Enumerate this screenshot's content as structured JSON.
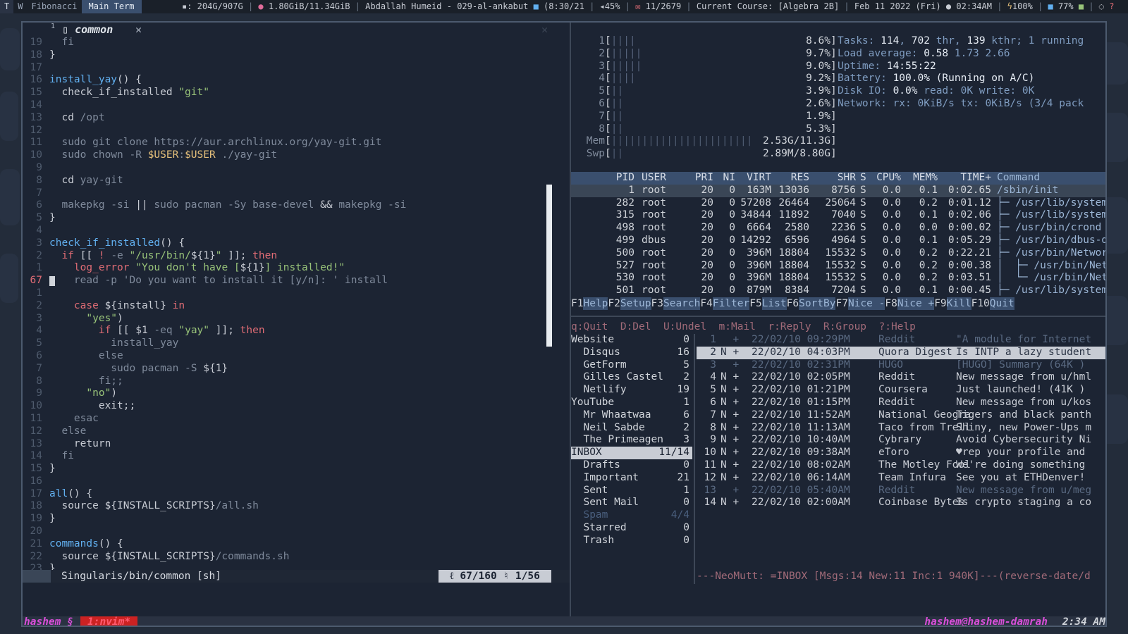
{
  "topbar": {
    "workspaces": [
      "T",
      "W",
      "Fibonacci",
      "Main Term"
    ],
    "disk": ": 204G/907G",
    "mem": "1.80GiB/11.34GiB",
    "now_playing": "Abdallah Humeid - 029-al-ankabut",
    "track_time": "(8:30/21",
    "volume": "45%",
    "mail_count": "11/2679",
    "course": "Current Course: [Algebra 2B]",
    "date": "Feb 11 2022 (Fri)",
    "time": "02:34AM",
    "battery": "100%",
    "brightness": "77%"
  },
  "editor": {
    "tab_number": "1",
    "tab_title": "common",
    "close_glyph": "✕",
    "lines": [
      {
        "n": "19",
        "html": "<span class='dim'>  fi</span>"
      },
      {
        "n": "18",
        "html": "}"
      },
      {
        "n": "17",
        "html": ""
      },
      {
        "n": "16",
        "html": "<span class='fn'>install_yay</span>() {"
      },
      {
        "n": "15",
        "html": "  check_if_installed <span class='str'>\"git\"</span>"
      },
      {
        "n": "14",
        "html": ""
      },
      {
        "n": "13",
        "html": "  cd <span class='dim'>/opt</span>"
      },
      {
        "n": "12",
        "html": ""
      },
      {
        "n": "11",
        "html": "<span class='dim'>  sudo git clone https://aur.archlinux.org/yay-git.git</span>"
      },
      {
        "n": "10",
        "html": "<span class='dim'>  sudo chown -R </span><span class='var'>$USER</span><span class='dim'>:</span><span class='var'>$USER</span><span class='dim'> ./yay-git</span>"
      },
      {
        "n": "9",
        "html": ""
      },
      {
        "n": "8",
        "html": "  cd <span class='dim'>yay-git</span>"
      },
      {
        "n": "7",
        "html": ""
      },
      {
        "n": "6",
        "html": "<span class='dim'>  makepkg -si </span>|| <span class='dim'>sudo pacman -Sy base-devel</span> &amp;&amp; <span class='dim'>makepkg -si</span>"
      },
      {
        "n": "5",
        "html": "}"
      },
      {
        "n": "4",
        "html": ""
      },
      {
        "n": "3",
        "html": "<span class='fn'>check_if_installed</span>() {"
      },
      {
        "n": "2",
        "html": "  <span class='kw'>if</span> [[ <span class='kw'>!</span> <span class='dim'>-e</span> <span class='str'>\"/usr/bin/</span>${1}<span class='str'>\"</span> ]]; <span class='kw'>then</span>"
      },
      {
        "n": "1",
        "html": "    <span class='kw'>log_error</span> <span class='str'>\"You don't have [</span>${1}<span class='str'>] installed!\"</span>"
      },
      {
        "n": "67",
        "html": "    <span class='dim'>read -p 'Do you want to install it [y/n]: ' install</span>",
        "current": true
      },
      {
        "n": "1",
        "html": ""
      },
      {
        "n": "2",
        "html": "    <span class='kw'>case</span> ${install} <span class='kw'>in</span>"
      },
      {
        "n": "3",
        "html": "      <span class='str'>\"yes\"</span>)"
      },
      {
        "n": "4",
        "html": "        <span class='kw'>if</span> [[ $1 <span class='dim'>-eq</span> <span class='str'>\"yay\"</span> ]]; <span class='kw'>then</span>"
      },
      {
        "n": "5",
        "html": "<span class='dim'>          install_yay</span>"
      },
      {
        "n": "6",
        "html": "<span class='dim'>        else</span>"
      },
      {
        "n": "7",
        "html": "<span class='dim'>          sudo pacman -S</span> ${1}"
      },
      {
        "n": "8",
        "html": "<span class='dim'>        fi;;</span>"
      },
      {
        "n": "9",
        "html": "      <span class='str'>\"no\"</span>)"
      },
      {
        "n": "10",
        "html": "        exit;;"
      },
      {
        "n": "11",
        "html": "<span class='dim'>    esac</span>"
      },
      {
        "n": "12",
        "html": "<span class='dim'>  else</span>"
      },
      {
        "n": "13",
        "html": "    return"
      },
      {
        "n": "14",
        "html": "<span class='dim'>  fi</span>"
      },
      {
        "n": "15",
        "html": "}"
      },
      {
        "n": "16",
        "html": ""
      },
      {
        "n": "17",
        "html": "<span class='fn'>all</span>() {"
      },
      {
        "n": "18",
        "html": "  source ${INSTALL_SCRIPTS}<span class='dim'>/all.sh</span>"
      },
      {
        "n": "19",
        "html": "}"
      },
      {
        "n": "20",
        "html": ""
      },
      {
        "n": "21",
        "html": "<span class='fn'>commands</span>() {"
      },
      {
        "n": "22",
        "html": "  source ${INSTALL_SCRIPTS}<span class='dim'>/commands.sh</span>"
      },
      {
        "n": "23",
        "html": "}"
      }
    ],
    "status_file": "Singularis/bin/common [sh]",
    "status_pos": "ℓ 67/160  ♮ 1/56"
  },
  "htop": {
    "cpus": [
      {
        "i": "1",
        "bars": "||||",
        "pct": "8.6%",
        "info": "Tasks: <b>114</b>, <b>702</b> thr, <b>139</b> kthr; 1 running"
      },
      {
        "i": "2",
        "bars": "|||||",
        "pct": "9.7%",
        "info": "Load average: <b>0.58</b> 1.73 2.66"
      },
      {
        "i": "3",
        "bars": "|||||",
        "pct": "9.0%",
        "info": "Uptime: <b>14:55:22</b>"
      },
      {
        "i": "4",
        "bars": "||||",
        "pct": "9.2%",
        "info": "Battery: <b>100.0% (Running on A/C)</b>"
      },
      {
        "i": "5",
        "bars": "||",
        "pct": "3.9%",
        "info": "Disk IO: <b>0.0%</b> read: 0K write: 0K"
      },
      {
        "i": "6",
        "bars": "||",
        "pct": "2.6%",
        "info": "Network: rx: 0KiB/s tx: 0KiB/s (3/4 pack"
      },
      {
        "i": "7",
        "bars": "||",
        "pct": "1.9%",
        "info": ""
      },
      {
        "i": "8",
        "bars": "||",
        "pct": "5.3%",
        "info": ""
      }
    ],
    "mem": {
      "label": "Mem",
      "bars": "|||||||||||||||||||||||",
      "value": "2.53G/11.3G"
    },
    "swp": {
      "label": "Swp",
      "bars": "||",
      "value": "2.89M/8.80G"
    },
    "header": {
      "pid": "PID",
      "user": "USER",
      "pri": "PRI",
      "ni": "NI",
      "virt": "VIRT",
      "res": "RES",
      "shr": "SHR",
      "s": "S",
      "cpu": "CPU%",
      "mem": "MEM%",
      "time": "TIME+",
      "cmd": "Command"
    },
    "processes": [
      {
        "pid": "1",
        "user": "root",
        "pri": "20",
        "ni": "0",
        "virt": "163M",
        "res": "13036",
        "shr": "8756",
        "s": "S",
        "cpu": "0.0",
        "mem": "0.1",
        "time": "0:02.65",
        "cmd": "/sbin/init"
      },
      {
        "pid": "282",
        "user": "root",
        "pri": "20",
        "ni": "0",
        "virt": "57208",
        "res": "26464",
        "shr": "25064",
        "s": "S",
        "cpu": "0.0",
        "mem": "0.2",
        "time": "0:01.12",
        "cmd": "├─ /usr/lib/system"
      },
      {
        "pid": "315",
        "user": "root",
        "pri": "20",
        "ni": "0",
        "virt": "34844",
        "res": "11892",
        "shr": "7040",
        "s": "S",
        "cpu": "0.0",
        "mem": "0.1",
        "time": "0:02.06",
        "cmd": "├─ /usr/lib/system"
      },
      {
        "pid": "498",
        "user": "root",
        "pri": "20",
        "ni": "0",
        "virt": "6664",
        "res": "2580",
        "shr": "2236",
        "s": "S",
        "cpu": "0.0",
        "mem": "0.0",
        "time": "0:00.02",
        "cmd": "├─ /usr/bin/crond"
      },
      {
        "pid": "499",
        "user": "dbus",
        "pri": "20",
        "ni": "0",
        "virt": "14292",
        "res": "6596",
        "shr": "4964",
        "s": "S",
        "cpu": "0.0",
        "mem": "0.1",
        "time": "0:05.29",
        "cmd": "├─ /usr/bin/dbus-d"
      },
      {
        "pid": "500",
        "user": "root",
        "pri": "20",
        "ni": "0",
        "virt": "396M",
        "res": "18804",
        "shr": "15532",
        "s": "S",
        "cpu": "0.0",
        "mem": "0.2",
        "time": "0:22.21",
        "cmd": "├─ /usr/bin/Networ"
      },
      {
        "pid": "527",
        "user": "root",
        "pri": "20",
        "ni": "0",
        "virt": "396M",
        "res": "18804",
        "shr": "15532",
        "s": "S",
        "cpu": "0.0",
        "mem": "0.2",
        "time": "0:00.38",
        "cmd": "│  ├─ /usr/bin/Net"
      },
      {
        "pid": "530",
        "user": "root",
        "pri": "20",
        "ni": "0",
        "virt": "396M",
        "res": "18804",
        "shr": "15532",
        "s": "S",
        "cpu": "0.0",
        "mem": "0.2",
        "time": "0:03.51",
        "cmd": "│  └─ /usr/bin/Net"
      },
      {
        "pid": "501",
        "user": "root",
        "pri": "20",
        "ni": "0",
        "virt": "879M",
        "res": "8384",
        "shr": "7204",
        "s": "S",
        "cpu": "0.0",
        "mem": "0.1",
        "time": "0:00.45",
        "cmd": "├─ /usr/lib/system"
      }
    ],
    "fkeys": [
      {
        "k": "F1",
        "l": "Help  "
      },
      {
        "k": "F2",
        "l": "Setup "
      },
      {
        "k": "F3",
        "l": "Search"
      },
      {
        "k": "F4",
        "l": "Filter"
      },
      {
        "k": "F5",
        "l": "List  "
      },
      {
        "k": "F6",
        "l": "SortBy"
      },
      {
        "k": "F7",
        "l": "Nice -"
      },
      {
        "k": "F8",
        "l": "Nice +"
      },
      {
        "k": "F9",
        "l": "Kill  "
      },
      {
        "k": "F10",
        "l": "Quit    "
      }
    ]
  },
  "mutt": {
    "help": "q:Quit  D:Del  U:Undel  m:Mail  r:Reply  R:Group  ?:Help",
    "sidebar": [
      {
        "name": "Website",
        "count": "0"
      },
      {
        "name": "  Disqus",
        "count": "16"
      },
      {
        "name": "  GetForm",
        "count": "5"
      },
      {
        "name": "  Gilles Castel",
        "count": "2"
      },
      {
        "name": "  Netlify",
        "count": "19"
      },
      {
        "name": "YouTube",
        "count": "1"
      },
      {
        "name": "  Mr Whaatwaa",
        "count": "6"
      },
      {
        "name": "  Neil Sabde",
        "count": "2"
      },
      {
        "name": "  The Primeagen",
        "count": "3"
      },
      {
        "name": "INBOX",
        "count": "11/14",
        "selected": true
      },
      {
        "name": "  Drafts",
        "count": "0"
      },
      {
        "name": "  Important",
        "count": "21"
      },
      {
        "name": "  Sent",
        "count": "1"
      },
      {
        "name": "  Sent Mail",
        "count": "0"
      },
      {
        "name": "  Spam",
        "count": "4/4",
        "spam": true
      },
      {
        "name": "  Starred",
        "count": "0"
      },
      {
        "name": "  Trash",
        "count": "0"
      }
    ],
    "messages": [
      {
        "n": "1",
        "f": "  +",
        "d": "22/02/10 09:29PM",
        "from": "Reddit",
        "subject": "\"A module for Internet",
        "read": true
      },
      {
        "n": "2",
        "f": "N +",
        "d": "22/02/10 04:03PM",
        "from": "Quora Digest",
        "subject": "Is INTP a lazy student",
        "selected": true
      },
      {
        "n": "3",
        "f": "  +",
        "d": "22/02/10 02:31PM",
        "from": "HUGO",
        "subject": "[HUGO] Summary (64K )",
        "read": true
      },
      {
        "n": "4",
        "f": "N +",
        "d": "22/02/10 02:05PM",
        "from": "Reddit",
        "subject": "New message from u/hml"
      },
      {
        "n": "5",
        "f": "N +",
        "d": "22/02/10 01:21PM",
        "from": "Coursera",
        "subject": "Just launched! (41K )"
      },
      {
        "n": "6",
        "f": "N +",
        "d": "22/02/10 01:15PM",
        "from": "Reddit",
        "subject": "New message from u/kos"
      },
      {
        "n": "7",
        "f": "N +",
        "d": "22/02/10 11:52AM",
        "from": "National Geogra",
        "subject": "Tigers and black panth"
      },
      {
        "n": "8",
        "f": "N +",
        "d": "22/02/10 11:13AM",
        "from": "Taco from Trell",
        "subject": "Shiny, new Power-Ups m"
      },
      {
        "n": "9",
        "f": "N +",
        "d": "22/02/10 10:40AM",
        "from": "Cybrary",
        "subject": "Avoid Cybersecurity Ni"
      },
      {
        "n": "10",
        "f": "N +",
        "d": "22/02/10 09:38AM",
        "from": "eToro",
        "subject": "♥rep your profile and"
      },
      {
        "n": "11",
        "f": "N +",
        "d": "22/02/10 08:02AM",
        "from": "The Motley Fool",
        "subject": "We're doing something"
      },
      {
        "n": "12",
        "f": "N +",
        "d": "22/02/10 06:14AM",
        "from": "Team Infura",
        "subject": "See you at ETHDenver!"
      },
      {
        "n": "13",
        "f": "  +",
        "d": "22/02/10 05:40AM",
        "from": "Reddit",
        "subject": "New message from u/meg",
        "read": true
      },
      {
        "n": "14",
        "f": "N +",
        "d": "22/02/10 02:00AM",
        "from": "Coinbase Bytes",
        "subject": "Is crypto staging a co"
      }
    ],
    "status": "---NeoMutt: =INBOX [Msgs:14 New:11 Inc:1 940K]---(reverse-date/d"
  },
  "tmux": {
    "user": "hashem §",
    "window": "1:nvim*",
    "host": "hashem@hashem-damrah",
    "clock": "2:34 AM"
  }
}
